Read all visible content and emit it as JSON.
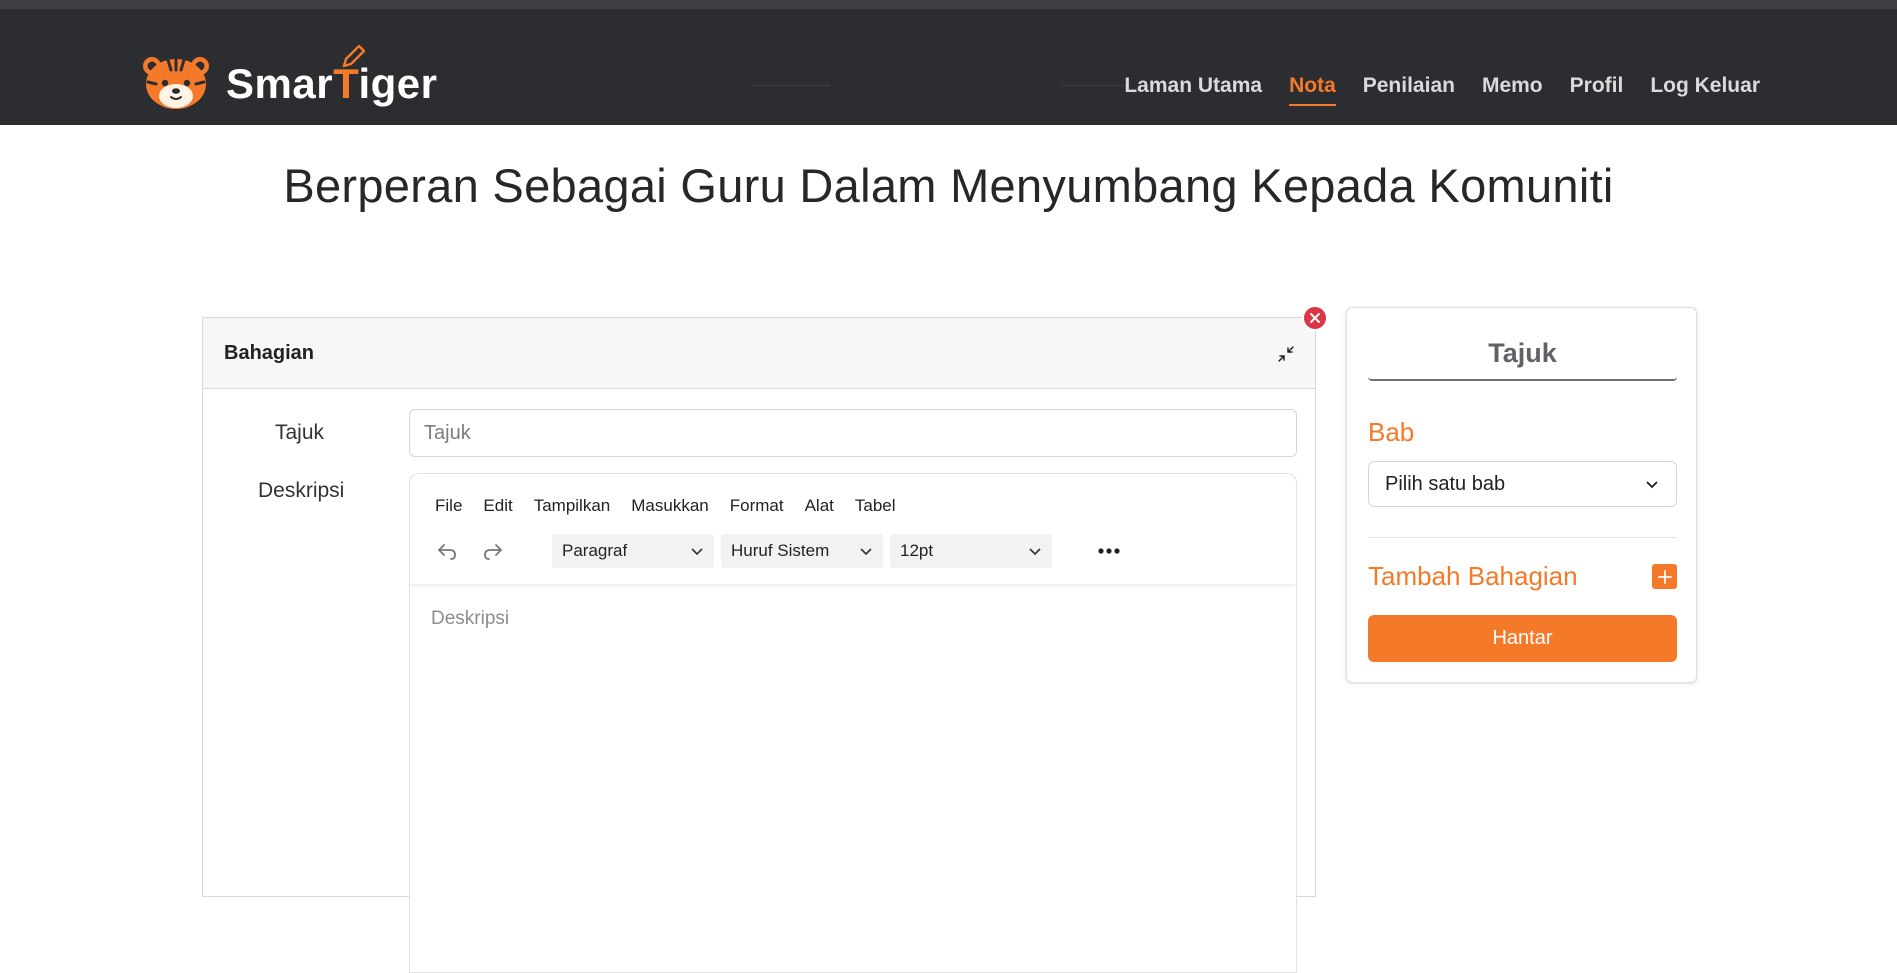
{
  "brand": {
    "name_part1": "Smar",
    "name_part2": "T",
    "name_part3": "iger",
    "accent_color": "#f47a2a"
  },
  "nav": {
    "items": [
      {
        "label": "Laman Utama",
        "active": false
      },
      {
        "label": "Nota",
        "active": true
      },
      {
        "label": "Penilaian",
        "active": false
      },
      {
        "label": "Memo",
        "active": false
      },
      {
        "label": "Profil",
        "active": false
      },
      {
        "label": "Log Keluar",
        "active": false
      }
    ]
  },
  "page": {
    "title": "Berperan Sebagai Guru Dalam Menyumbang Kepada Komuniti"
  },
  "section": {
    "header": "Bahagian",
    "tajuk_label": "Tajuk",
    "tajuk_placeholder": "Tajuk",
    "deskripsi_label": "Deskripsi",
    "editor": {
      "menu": [
        "File",
        "Edit",
        "Tampilkan",
        "Masukkan",
        "Format",
        "Alat",
        "Tabel"
      ],
      "block_format": "Paragraf",
      "font_family": "Huruf Sistem",
      "font_size": "12pt",
      "placeholder": "Deskripsi"
    }
  },
  "sidebar": {
    "title": "Tajuk",
    "bab_label": "Bab",
    "bab_select": "Pilih satu bab",
    "add_section_label": "Tambah Bahagian",
    "submit_label": "Hantar"
  },
  "icons": {
    "undo": "undo-icon",
    "redo": "redo-icon",
    "more": "more-horizontal-icon",
    "collapse": "collapse-icon",
    "close": "close-icon",
    "chevron": "chevron-down-icon",
    "plus": "plus-icon",
    "logo": "tiger-logo-icon"
  }
}
